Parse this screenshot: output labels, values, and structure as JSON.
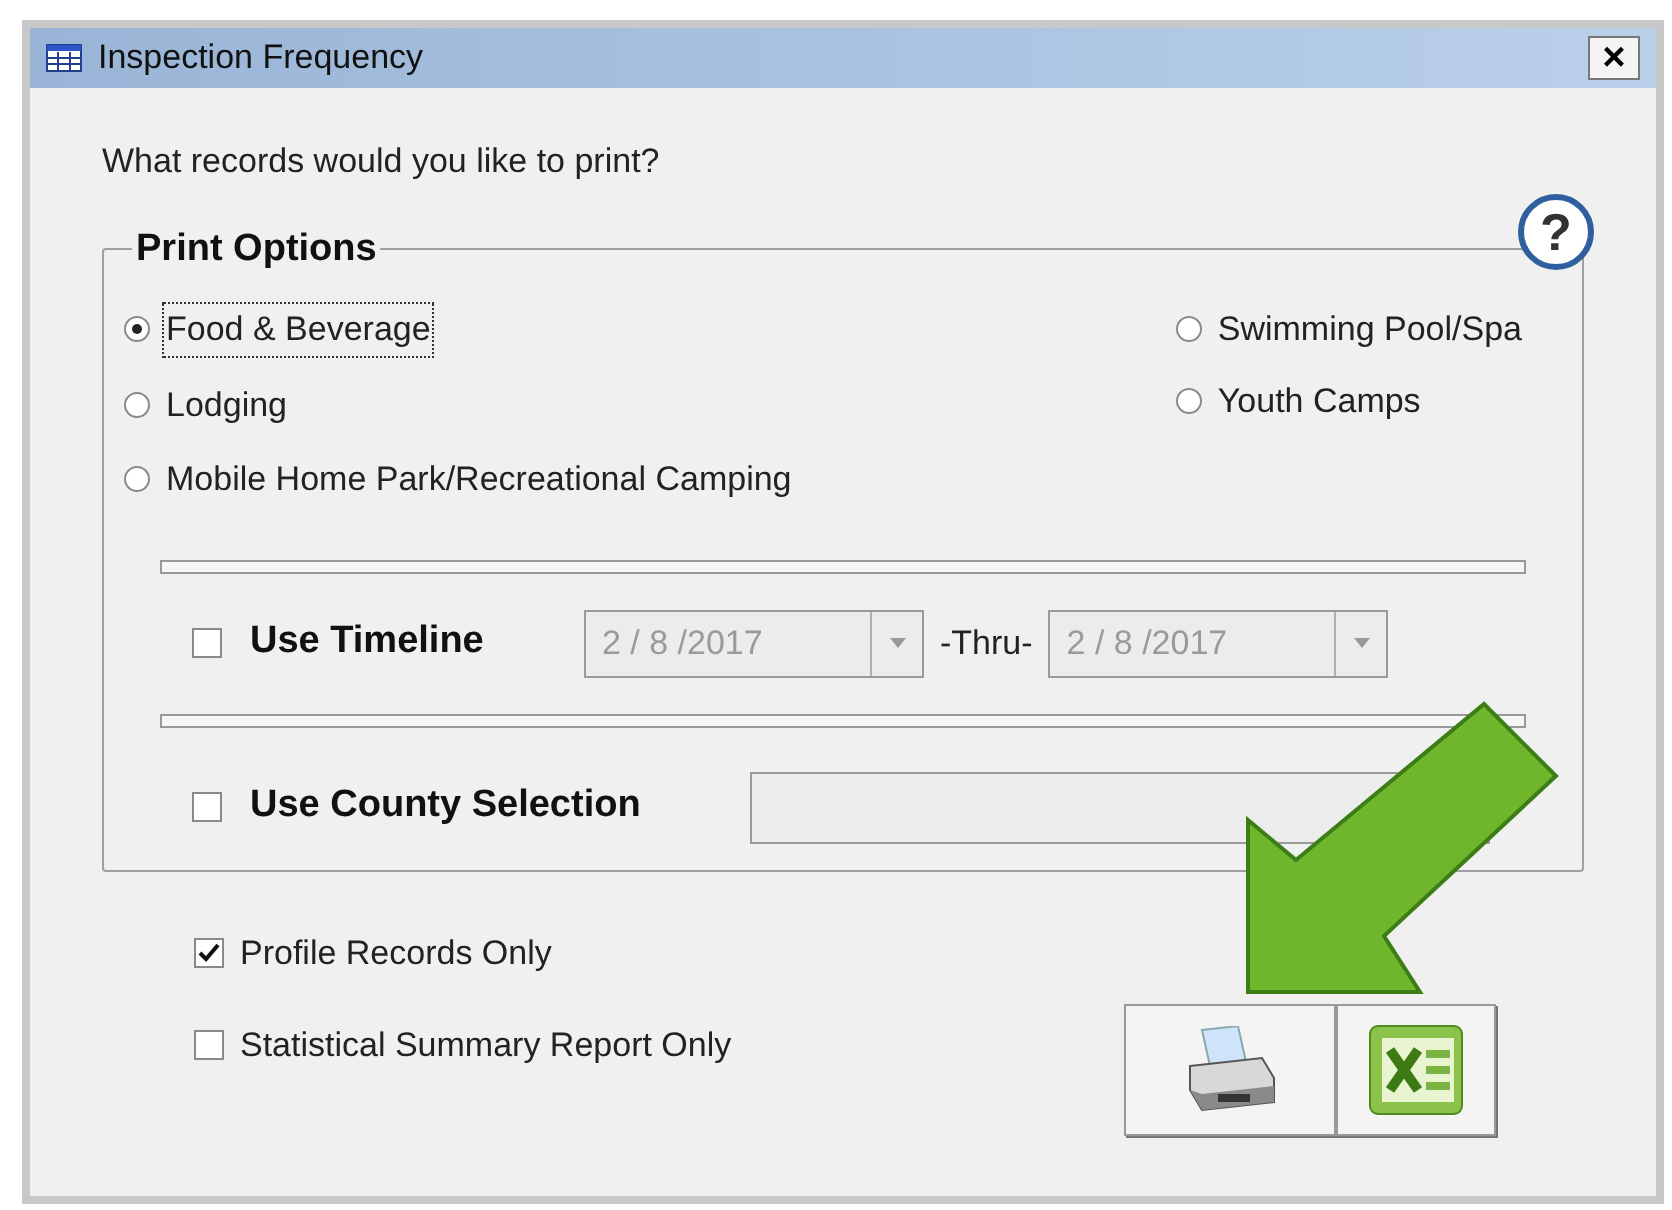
{
  "window": {
    "title": "Inspection Frequency",
    "close": "×"
  },
  "prompt": "What records would you like to print?",
  "print_options": {
    "title": "Print Options",
    "help": "?",
    "left": [
      {
        "label": "Food & Beverage",
        "selected": true
      },
      {
        "label": "Lodging",
        "selected": false
      },
      {
        "label": "Mobile Home Park/Recreational Camping",
        "selected": false
      }
    ],
    "right": [
      {
        "label": "Swimming Pool/Spa",
        "selected": false
      },
      {
        "label": "Youth Camps",
        "selected": false
      }
    ],
    "timeline": {
      "label": "Use Timeline",
      "checked": false,
      "from": "2 / 8 /2017",
      "thru": "-Thru-",
      "to": "2 / 8 /2017"
    },
    "county": {
      "label": "Use County Selection",
      "checked": false
    }
  },
  "options": [
    {
      "label": "Profile Records Only",
      "checked": true
    },
    {
      "label": "Statistical Summary Report Only",
      "checked": false
    }
  ]
}
